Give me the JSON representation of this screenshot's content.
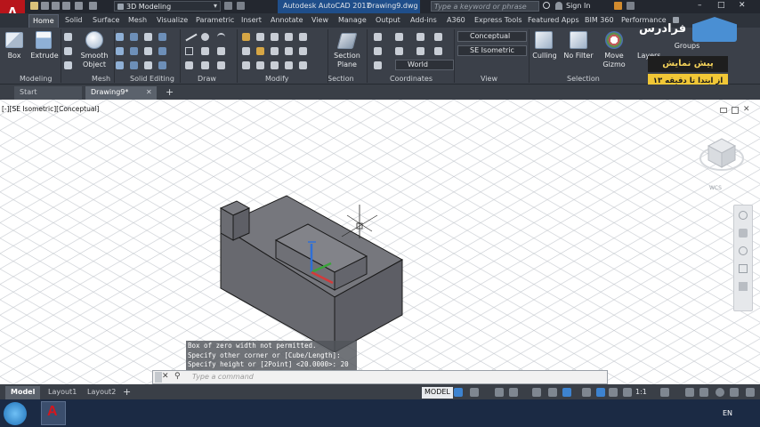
{
  "app": {
    "title": "Autodesk AutoCAD 2017",
    "file": "Drawing9.dwg",
    "workspace": "3D Modeling",
    "search_placeholder": "Type a keyword or phrase",
    "signin": "Sign In",
    "app_letter": "A"
  },
  "ribbon_tabs": [
    "Home",
    "Solid",
    "Surface",
    "Mesh",
    "Visualize",
    "Parametric",
    "Insert",
    "Annotate",
    "View",
    "Manage",
    "Output",
    "Add-ins",
    "A360",
    "Express Tools",
    "Featured Apps",
    "BIM 360",
    "Performance"
  ],
  "ribbon": {
    "box": "Box",
    "extrude": "Extrude",
    "smooth_object": [
      "Smooth",
      "Object"
    ],
    "section_plane": [
      "Section",
      "Plane"
    ],
    "culling": "Culling",
    "no_filter": "No Filter",
    "move_gizmo": [
      "Move",
      "Gizmo"
    ],
    "layers": "Layers",
    "groups": "Groups",
    "visual_style": "Conceptual",
    "view_name": "SE Isometric",
    "ucs_name": "World",
    "panels": [
      "Modeling",
      "Mesh",
      "Solid Editing",
      "Draw",
      "Modify",
      "Section",
      "Coordinates",
      "View",
      "Selection"
    ]
  },
  "watermark": {
    "brand": "فرادرس",
    "line1": "پیش نمایش",
    "line2": "از ابتدا تا دقیقه ۱۳"
  },
  "doc_tabs": [
    "Start",
    "Drawing9*"
  ],
  "viewport": {
    "label": "[-][SE Isometric][Conceptual]",
    "wcs": "WCS"
  },
  "command": {
    "history": [
      "Box of zero width not permitted.",
      "Specify other corner or [Cube/Length]:",
      "Specify height or [2Point] <20.0000>: 20"
    ],
    "placeholder": "Type a command"
  },
  "layout_tabs": [
    "Model",
    "Layout1",
    "Layout2"
  ],
  "status": {
    "model": "MODEL",
    "scale": "1:1"
  },
  "taskbar": {
    "lang": "EN"
  },
  "colors": {
    "accent": "#b8151b",
    "ribbon_bg": "#3b4049",
    "solid_top": "#75767c",
    "solid_side": "#5e5f66",
    "solid_front": "#6a6b71"
  }
}
